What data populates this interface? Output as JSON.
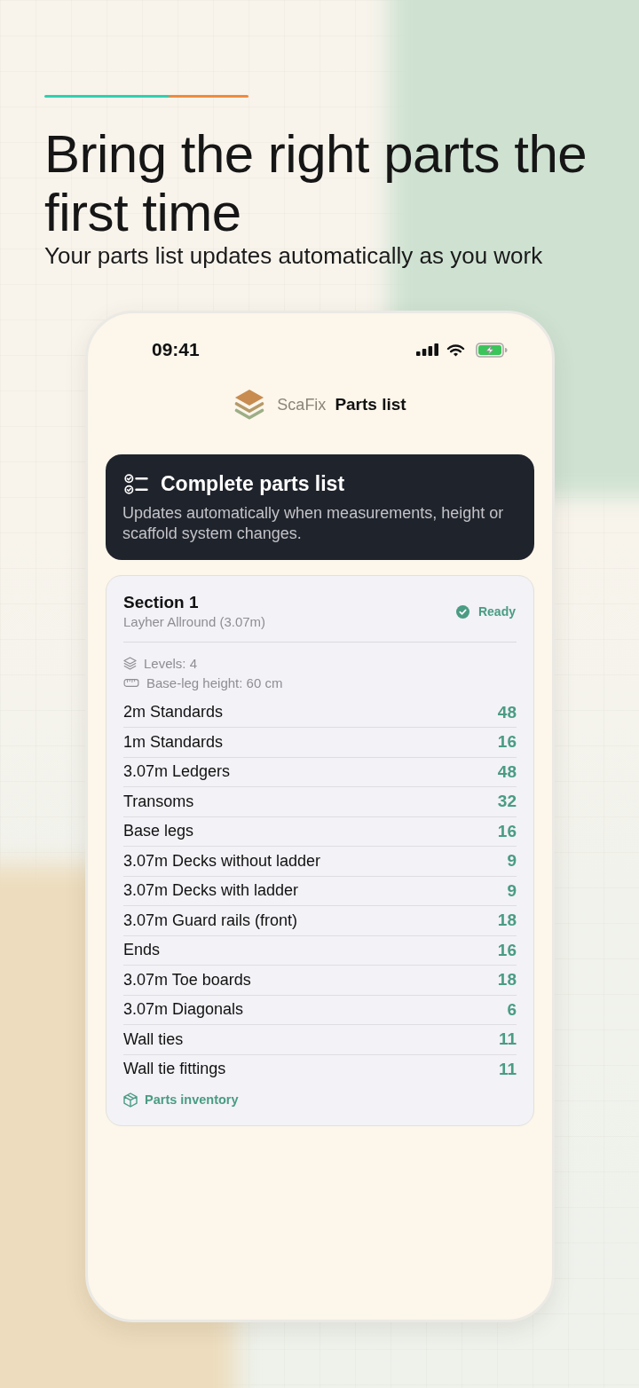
{
  "hero": {
    "title": "Bring the right parts the first time",
    "subtitle": "Your parts list updates automatically as you work"
  },
  "status_bar": {
    "time": "09:41"
  },
  "header": {
    "brand": "ScaFix",
    "title": "Parts list"
  },
  "info_card": {
    "title": "Complete parts list",
    "text": "Updates automatically when measurements, height or scaffold system changes."
  },
  "section": {
    "title": "Section 1",
    "system": "Layher Allround (3.07m)",
    "status": "Ready",
    "details": [
      {
        "kind": "levels",
        "text": "Levels: 4"
      },
      {
        "kind": "base_leg",
        "text": "Base-leg height: 60 cm"
      }
    ],
    "parts": [
      {
        "name": "2m Standards",
        "count": "48"
      },
      {
        "name": "1m Standards",
        "count": "16"
      },
      {
        "name": "3.07m Ledgers",
        "count": "48"
      },
      {
        "name": "Transoms",
        "count": "32"
      },
      {
        "name": "Base legs",
        "count": "16"
      },
      {
        "name": "3.07m Decks without ladder",
        "count": "9"
      },
      {
        "name": "3.07m Decks with ladder",
        "count": "9"
      },
      {
        "name": "3.07m Guard rails (front)",
        "count": "18"
      },
      {
        "name": "Ends",
        "count": "16"
      },
      {
        "name": "3.07m Toe boards",
        "count": "18"
      },
      {
        "name": "3.07m Diagonals",
        "count": "6"
      },
      {
        "name": "Wall ties",
        "count": "11"
      },
      {
        "name": "Wall tie fittings",
        "count": "11"
      }
    ],
    "link": "Parts inventory"
  }
}
